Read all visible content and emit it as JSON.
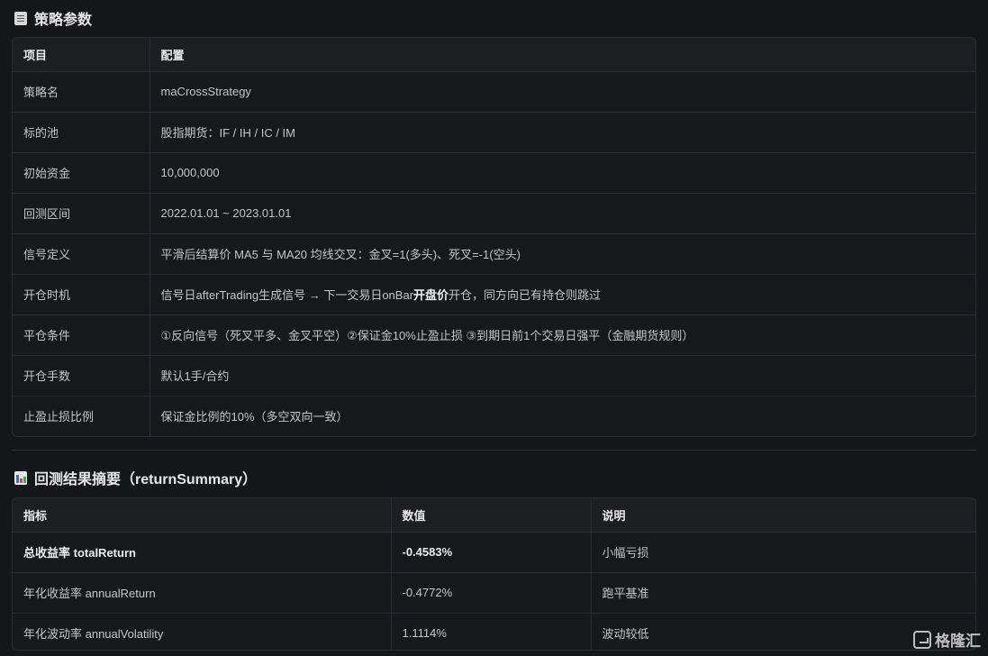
{
  "strategy_section": {
    "title": "策略参数",
    "icon": "document-icon",
    "headers": [
      "项目",
      "配置"
    ],
    "rows": [
      {
        "item": "策略名",
        "config_pre": "maCrossStrategy",
        "config_bold": "",
        "config_post": ""
      },
      {
        "item": "标的池",
        "config_pre": "股指期货：IF / IH / IC / IM",
        "config_bold": "",
        "config_post": ""
      },
      {
        "item": "初始资金",
        "config_pre": "10,000,000",
        "config_bold": "",
        "config_post": ""
      },
      {
        "item": "回测区间",
        "config_pre": "2022.01.01 ~ 2023.01.01",
        "config_bold": "",
        "config_post": ""
      },
      {
        "item": "信号定义",
        "config_pre": "平滑后结算价 MA5 与 MA20 均线交叉：金叉=1(多头)、死叉=-1(空头)",
        "config_bold": "",
        "config_post": ""
      },
      {
        "item": "开仓时机",
        "config_pre": "信号日afterTrading生成信号 → 下一交易日onBar",
        "config_bold": "开盘价",
        "config_post": "开仓，同方向已有持仓则跳过"
      },
      {
        "item": "平仓条件",
        "config_pre": "①反向信号（死叉平多、金叉平空）②保证金10%止盈止损 ③到期日前1个交易日强平（金融期货规则）",
        "config_bold": "",
        "config_post": ""
      },
      {
        "item": "开仓手数",
        "config_pre": "默认1手/合约",
        "config_bold": "",
        "config_post": ""
      },
      {
        "item": "止盈止损比例",
        "config_pre": "保证金比例的10%（多空双向一致）",
        "config_bold": "",
        "config_post": ""
      }
    ]
  },
  "summary_section": {
    "title": "回测结果摘要（returnSummary）",
    "icon": "bar-chart-icon",
    "headers": [
      "指标",
      "数值",
      "说明"
    ],
    "rows": [
      {
        "metric": "总收益率 totalReturn",
        "value": "-0.4583%",
        "note": "小幅亏损",
        "bold": true
      },
      {
        "metric": "年化收益率 annualReturn",
        "value": "-0.4772%",
        "note": "跑平基准",
        "bold": false
      },
      {
        "metric": "年化波动率 annualVolatility",
        "value": "1.1114%",
        "note": "波动较低",
        "bold": false
      }
    ]
  },
  "watermark": {
    "text": "格隆汇",
    "icon": "gelonghui-logo-icon"
  },
  "colors": {
    "background": "#15161a",
    "header_bg": "#1d1e22",
    "border": "#2b2c31"
  }
}
